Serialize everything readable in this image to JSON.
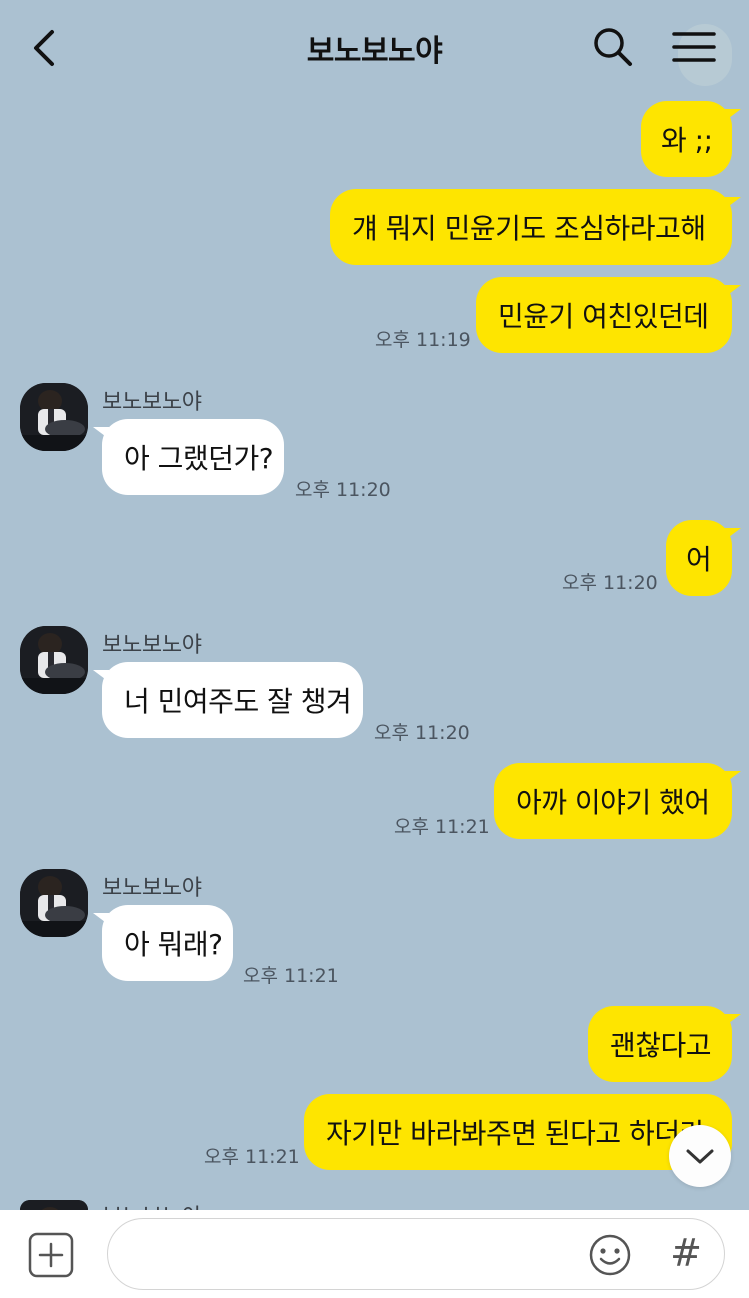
{
  "header": {
    "title": "보노보노야",
    "back_icon": "chevron-left-icon",
    "search_icon": "search-icon",
    "menu_icon": "hamburger-menu-icon"
  },
  "colors": {
    "background": "#abc1d1",
    "my_bubble": "#fee500",
    "other_bubble": "#ffffff"
  },
  "messages": [
    {
      "from": "me",
      "text": "와 ;;"
    },
    {
      "from": "me",
      "text": "걔 뭐지 민윤기도 조심하라고해"
    },
    {
      "from": "me",
      "text": "민윤기 여친있던데",
      "time": "오후 11:19"
    },
    {
      "from": "other",
      "sender": "보노보노야",
      "text": "아 그랬던가?",
      "time": "오후 11:20"
    },
    {
      "from": "me",
      "text": "어",
      "time": "오후 11:20"
    },
    {
      "from": "other",
      "sender": "보노보노야",
      "text": "너 민여주도 잘 챙겨",
      "time": "오후 11:20"
    },
    {
      "from": "me",
      "text": "아까 이야기 했어",
      "time": "오후 11:21"
    },
    {
      "from": "other",
      "sender": "보노보노야",
      "text": "아 뭐래?",
      "time": "오후 11:21"
    },
    {
      "from": "me",
      "text": "괜찮다고"
    },
    {
      "from": "me",
      "text": "자기만 바라봐주면 된다고 하더라",
      "time": "오후 11:21"
    },
    {
      "from": "other",
      "sender": "보노보노야"
    }
  ],
  "input_bar": {
    "placeholder": "",
    "plus_icon": "plus-square-icon",
    "emoji_icon": "emoji-icon",
    "hash_label": "#"
  },
  "scroll_down_icon": "chevron-down-icon"
}
